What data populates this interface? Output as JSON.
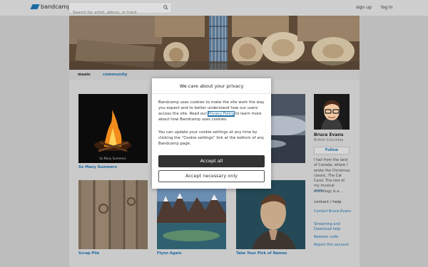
{
  "header": {
    "logo_text": "bandcamp",
    "search_placeholder": "Search for artist, album, or track",
    "signup": "sign up",
    "login": "log in"
  },
  "tabs": [
    {
      "label": "music"
    },
    {
      "label": "community"
    }
  ],
  "albums": [
    {
      "title": "So Many Summers",
      "cover_caption": "So Many Summers"
    },
    {
      "title": "Scrap Pile"
    },
    {
      "title": "Flynn Again"
    },
    {
      "title": "Take Your Pick of Names"
    }
  ],
  "artist": {
    "name": "Bruce Evans",
    "location": "British Columbia",
    "follow": "Follow",
    "bio": "I hail from the land of Canada, where I wrote the Christmas classic, The Cat Carol. The rest of my musical anthology is a...",
    "more": "more"
  },
  "sidebar": {
    "contact_heading": "contact / help",
    "links": [
      "Contact Bruce Evans",
      "Streaming and Download help",
      "Redeem code",
      "Report this account"
    ]
  },
  "privacy_dialog": {
    "title": "We care about your privacy",
    "para1_before": "Bandcamp uses cookies to make the site work the way you expect and to better understand how our users access the site. Read our ",
    "policy_link": "Privacy Policy",
    "para1_after": " to learn more about how Bandcamp uses cookies.",
    "para2": "You can update your cookie settings at any time by clicking the “Cookie settings” link at the bottom of any Bandcamp page.",
    "accept_all": "Accept all",
    "accept_necessary": "Accept necessary only"
  },
  "colors": {
    "link_blue": "#1e6aa1",
    "button_dark": "#333333"
  }
}
